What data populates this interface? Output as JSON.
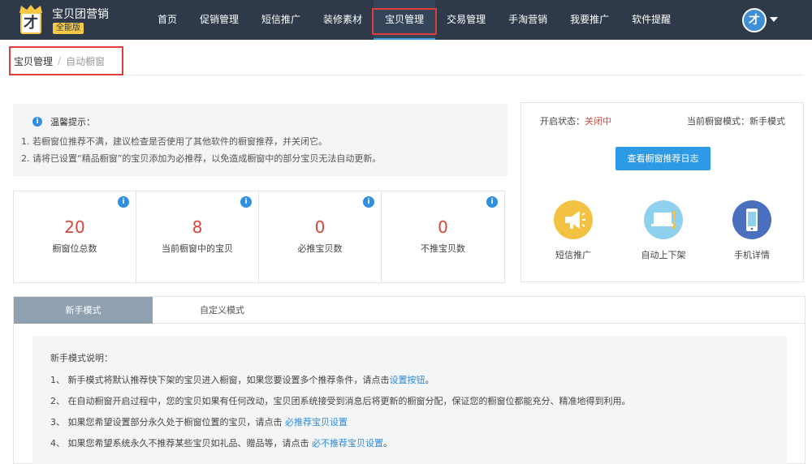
{
  "header": {
    "brand_title": "宝贝团营销",
    "brand_badge": "全能版",
    "logo_glyph": "才",
    "avatar_glyph": "才",
    "nav": [
      "首页",
      "促销管理",
      "短信推广",
      "装修素材",
      "宝贝管理",
      "交易管理",
      "手淘营销",
      "我要推广",
      "软件提醒"
    ],
    "active_nav": "宝贝管理"
  },
  "breadcrumb": {
    "current": "宝贝管理",
    "separator": "/",
    "sub": "自动橱窗"
  },
  "tips": {
    "title": "温馨提示：",
    "lines": [
      "1. 若橱窗位推荐不满，建议检查是否使用了其他软件的橱窗推荐，并关闭它。",
      "2. 请将已设置“精品橱窗”的宝贝添加为必推荐，以免造成橱窗中的部分宝贝无法自动更新。"
    ]
  },
  "stats": [
    {
      "value": "20",
      "label": "橱窗位总数"
    },
    {
      "value": "8",
      "label": "当前橱窗中的宝贝"
    },
    {
      "value": "0",
      "label": "必推宝贝数"
    },
    {
      "value": "0",
      "label": "不推宝贝数"
    }
  ],
  "panel": {
    "status_label": "开启状态：",
    "status_value": "关闭中",
    "mode_label": "当前橱窗模式：",
    "mode_value": "新手模式",
    "log_button": "查看橱窗推荐日志",
    "shortcuts": [
      {
        "label": "短信推广",
        "icon": "megaphone-icon"
      },
      {
        "label": "自动上下架",
        "icon": "laptop-arrows-icon"
      },
      {
        "label": "手机详情",
        "icon": "phone-icon"
      }
    ]
  },
  "tabs": [
    "新手模式",
    "自定义模式"
  ],
  "description": {
    "title": "新手模式说明：",
    "lines": [
      {
        "text": "1、 新手模式将默认推荐快下架的宝贝进入橱窗，如果您要设置多个推荐条件，请点击",
        "link": "设置按钮",
        "suffix": "。"
      },
      {
        "text": "2、 在自动橱窗开启过程中，您的宝贝如果有任何改动，宝贝团系统接受到消息后将更新的橱窗分配，保证您的橱窗位都能充分、精准地得到利用。",
        "link": "",
        "suffix": ""
      },
      {
        "text": "3、 如果您希望设置部分永久处于橱窗位置的宝贝，请点击 ",
        "link": "必推荐宝贝设置",
        "suffix": ""
      },
      {
        "text": "4、 如果您希望系统永久不推荐某些宝贝如礼品、赠品等，请点击 ",
        "link": "必不推荐宝贝设置",
        "suffix": "。"
      }
    ]
  },
  "colors": {
    "topbar": "#2e3a4a",
    "accent_blue": "#2e9ae6",
    "stat_red": "#d9453d",
    "highlight_red": "#e03c3c",
    "tab_active": "#8fa1b1"
  }
}
